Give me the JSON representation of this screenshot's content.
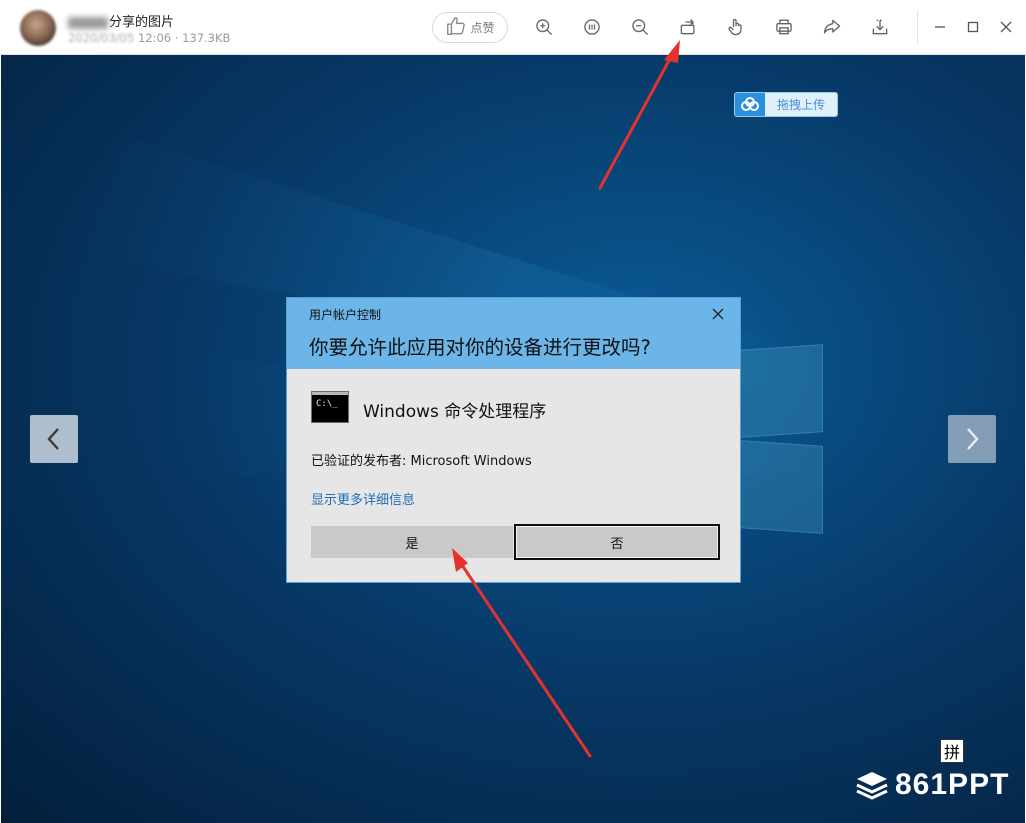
{
  "header": {
    "title_suffix": "分享的图片",
    "date_blurred": "2020/03/05",
    "time": "12:06",
    "separator": "·",
    "file_size": "137.3KB",
    "like_label": "点赞"
  },
  "toolbar": {
    "icons": [
      "zoom-in-icon",
      "original-size-icon",
      "zoom-out-icon",
      "rotate-icon",
      "hand-pan-icon",
      "print-icon",
      "share-icon",
      "download-icon"
    ],
    "window_controls": [
      "minimize-icon",
      "maximize-icon",
      "close-icon"
    ]
  },
  "viewer": {
    "upload_label": "拖拽上传"
  },
  "uac_dialog": {
    "caption": "用户帐户控制",
    "question": "你要允许此应用对你的设备进行更改吗?",
    "app_name": "Windows 命令处理程序",
    "cmd_icon_text": "C:\\_",
    "publisher": "已验证的发布者: Microsoft Windows",
    "more_details": "显示更多详细信息",
    "yes_label": "是",
    "no_label": "否"
  },
  "watermark": {
    "ime_char": "拼",
    "brand": "861PPT"
  },
  "colors": {
    "dialog_header": "#6bb5e8",
    "link": "#1c6fb8",
    "arrow": "#e5322d",
    "desktop_bg": "#073866"
  }
}
